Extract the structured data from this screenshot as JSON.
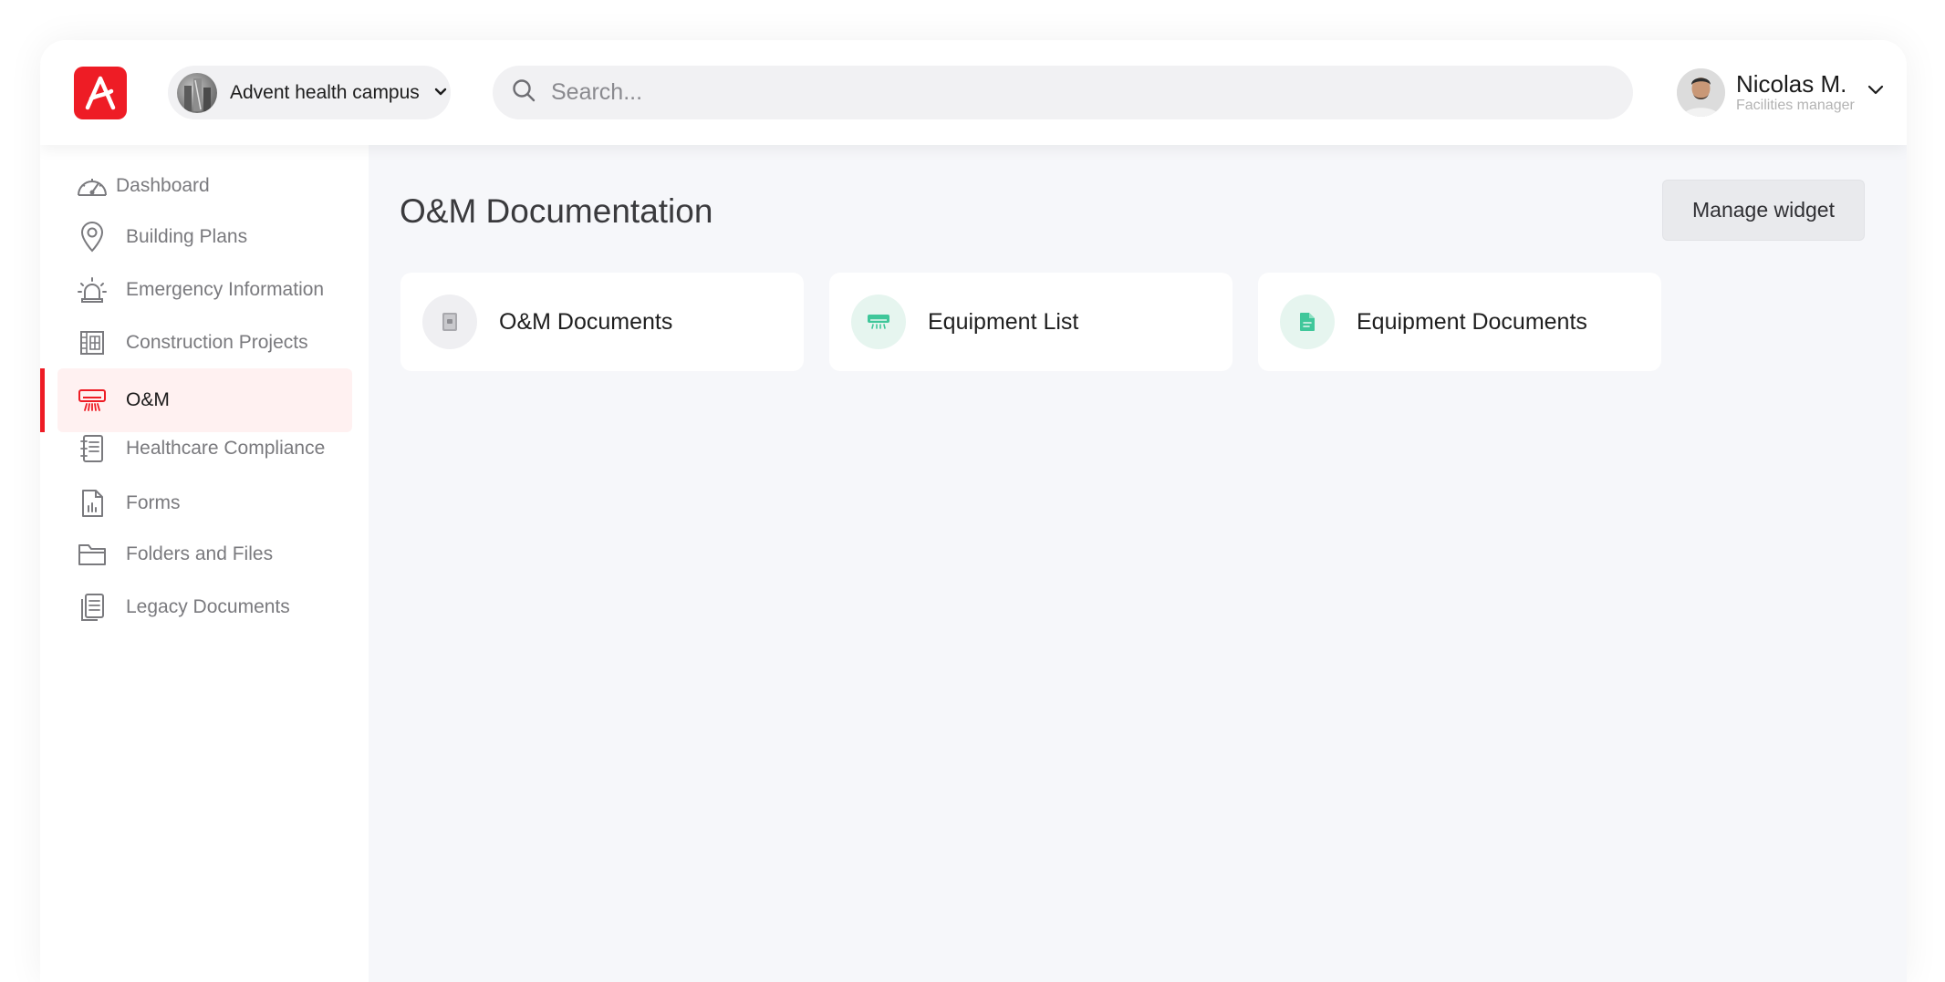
{
  "header": {
    "campus": {
      "label": "Advent health campus"
    },
    "search": {
      "placeholder": "Search..."
    },
    "user": {
      "name": "Nicolas M.",
      "role": "Facilities manager"
    }
  },
  "sidebar": {
    "items": [
      {
        "label": "Dashboard",
        "icon": "dashboard-gauge-icon"
      },
      {
        "label": "Building Plans",
        "icon": "map-pin-icon"
      },
      {
        "label": "Emergency Information",
        "icon": "siren-icon"
      },
      {
        "label": "Construction Projects",
        "icon": "building-icon"
      },
      {
        "label": "O&M",
        "icon": "air-conditioner-icon",
        "active": true
      },
      {
        "label": "Healthcare Compliance",
        "icon": "notebook-icon"
      },
      {
        "label": "Forms",
        "icon": "form-document-icon"
      },
      {
        "label": "Folders and Files",
        "icon": "folder-icon"
      },
      {
        "label": "Legacy Documents",
        "icon": "documents-stack-icon"
      }
    ]
  },
  "main": {
    "title": "O&M Documentation",
    "manage_label": "Manage widget",
    "cards": [
      {
        "label": "O&M Documents",
        "icon": "book-icon"
      },
      {
        "label": "Equipment List",
        "icon": "air-conditioner-icon"
      },
      {
        "label": "Equipment Documents",
        "icon": "file-icon"
      }
    ]
  },
  "colors": {
    "brand": "#ee1c25",
    "active_bg": "#fff1f1",
    "accent_green": "#3fc79a",
    "main_bg": "#f6f7fa"
  }
}
